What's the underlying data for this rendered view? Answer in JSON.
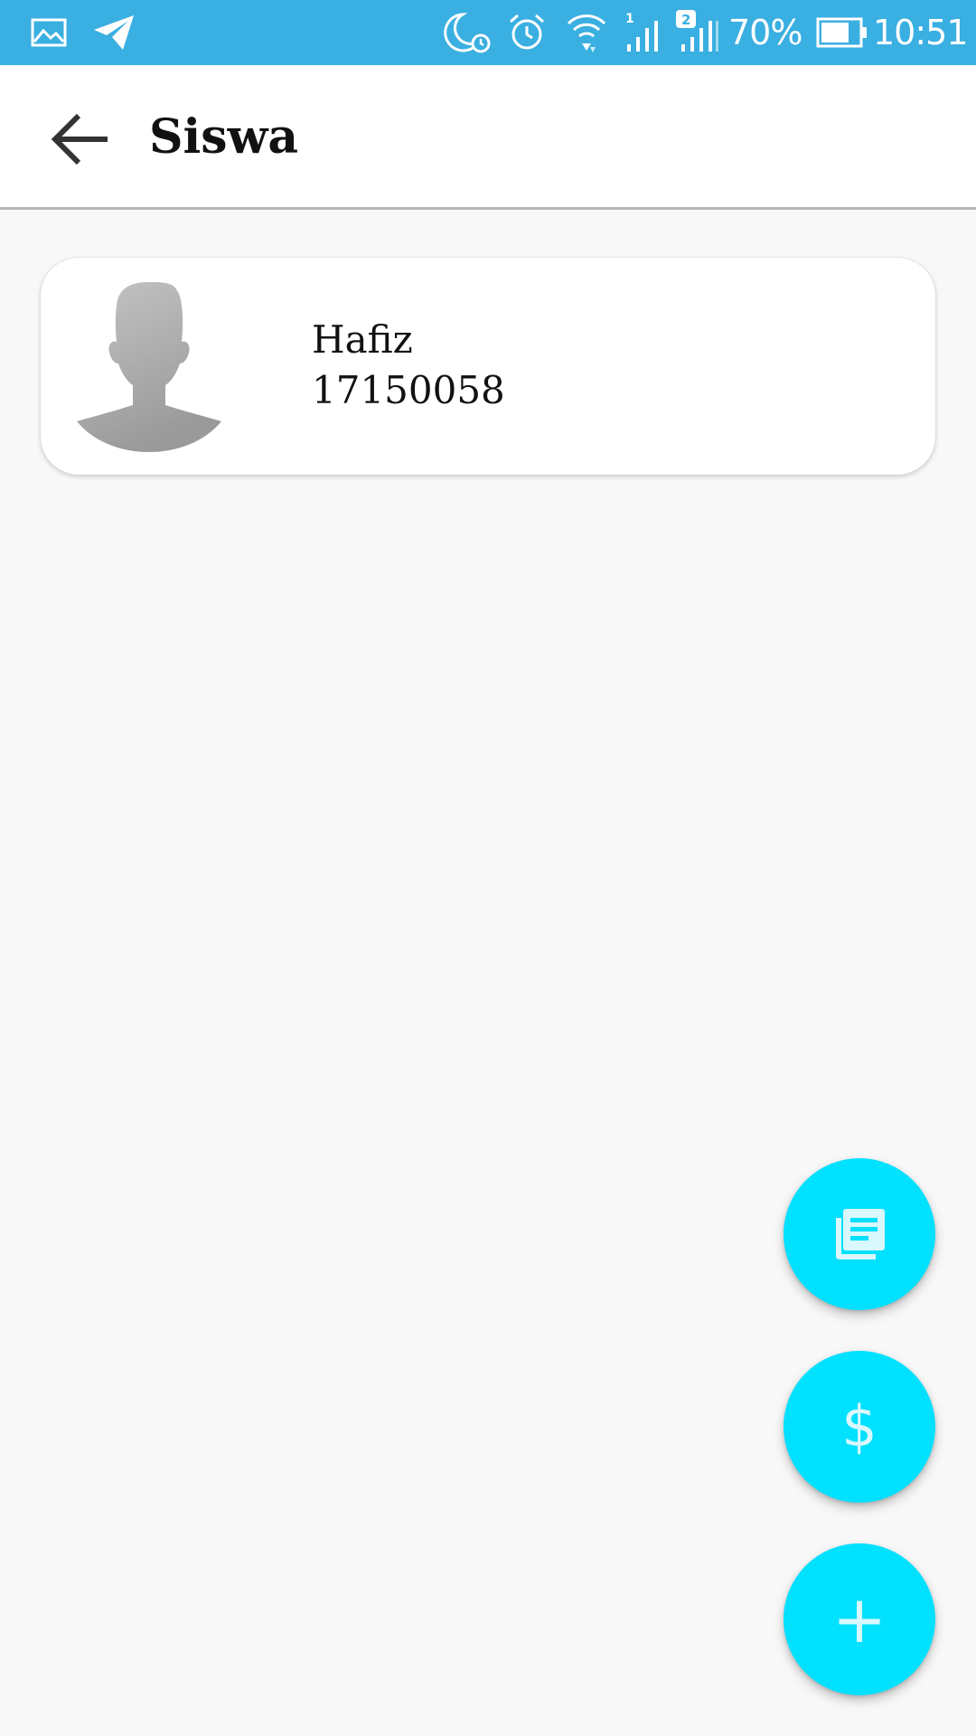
{
  "status_bar": {
    "battery_percent": "70%",
    "time": "10:51",
    "sim1_label": "1",
    "sim2_label": "2",
    "icons": [
      "gallery-icon",
      "telegram-icon",
      "do-not-disturb-icon",
      "alarm-icon",
      "wifi-icon",
      "signal-icon",
      "signal-icon",
      "battery-icon"
    ]
  },
  "app_bar": {
    "title": "Siswa",
    "back_icon": "arrow-left-icon"
  },
  "students": [
    {
      "name": "Hafiz",
      "id": "17150058",
      "avatar_icon": "default-avatar-icon"
    }
  ],
  "fabs": {
    "report_icon": "report-icon",
    "payment_label": "$",
    "add_label": "+"
  },
  "colors": {
    "status_bar": "#3aafe1",
    "fab": "#00e0ff",
    "background": "#f8f8f8"
  }
}
